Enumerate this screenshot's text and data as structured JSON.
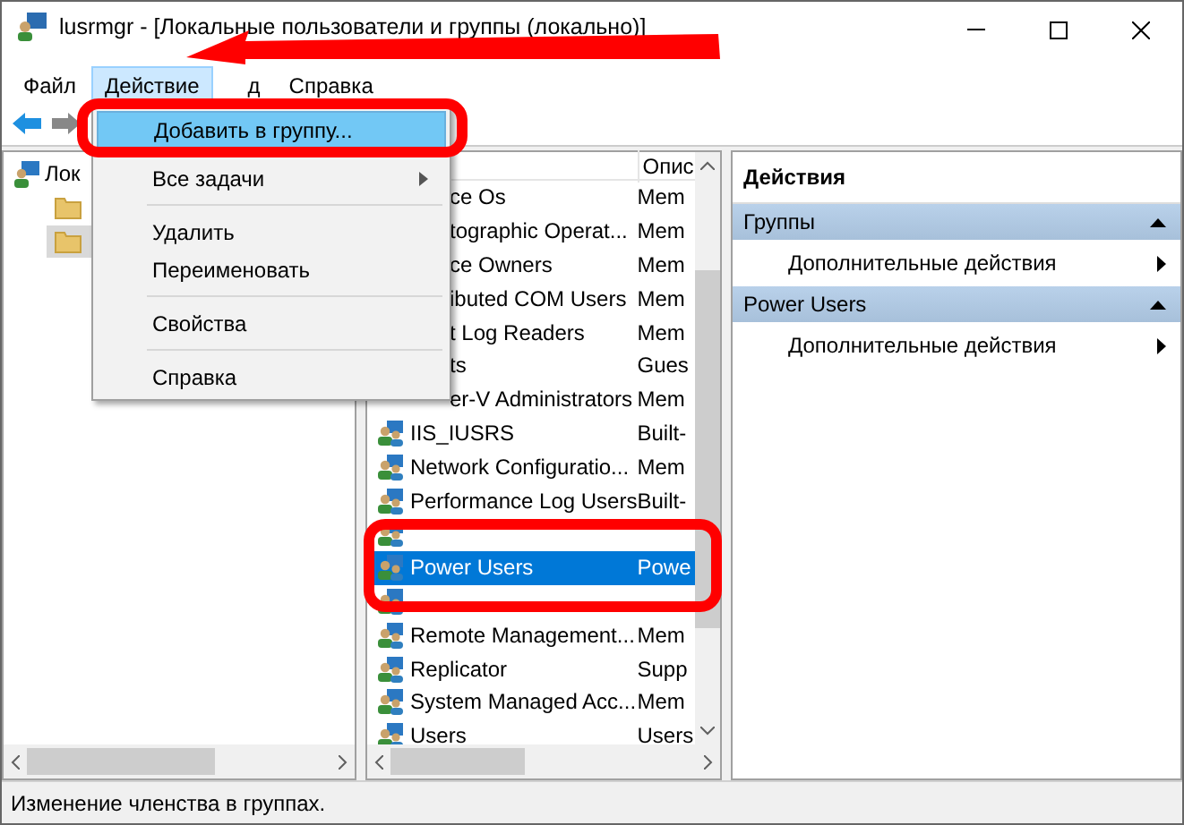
{
  "window": {
    "title": "lusrmgr - [Локальные пользователи и группы (локально)]"
  },
  "menu_bar": [
    {
      "label": "Файл",
      "selected": false
    },
    {
      "label": "Действие",
      "selected": true
    },
    {
      "label": "д",
      "selected": false
    },
    {
      "label": "Справка",
      "selected": false
    }
  ],
  "context_menu": [
    {
      "kind": "item",
      "label": "Добавить в группу...",
      "selected": true
    },
    {
      "kind": "submenu",
      "label": "Все задачи",
      "selected": false
    },
    {
      "kind": "separator"
    },
    {
      "kind": "item",
      "label": "Удалить",
      "selected": false
    },
    {
      "kind": "item",
      "label": "Переименовать",
      "selected": false
    },
    {
      "kind": "separator"
    },
    {
      "kind": "item",
      "label": "Свойства",
      "selected": false
    },
    {
      "kind": "separator"
    },
    {
      "kind": "item",
      "label": "Справка",
      "selected": false
    }
  ],
  "tree": {
    "label": "Лок",
    "children": [
      {
        "selected": false
      },
      {
        "selected": true
      }
    ]
  },
  "list": {
    "columns": [
      "Опис"
    ],
    "rows": [
      {
        "kind": "covered",
        "name": "ce Os",
        "description": "Mem",
        "selected": false
      },
      {
        "kind": "covered",
        "name": "tographic Operat...",
        "description": "Mem",
        "selected": false
      },
      {
        "kind": "covered",
        "name": "ce Owners",
        "description": "Mem",
        "selected": false
      },
      {
        "kind": "covered",
        "name": "ibuted COM Users",
        "description": "Mem",
        "selected": false
      },
      {
        "kind": "covered",
        "name": "t Log Readers",
        "description": "Mem",
        "selected": false
      },
      {
        "kind": "covered",
        "name": "ts",
        "description": "Gues",
        "selected": false
      },
      {
        "kind": "covered",
        "name": "er-V Administrators",
        "description": "Mem",
        "selected": false
      },
      {
        "kind": "group",
        "name": "IIS_IUSRS",
        "description": "Built-",
        "selected": false
      },
      {
        "kind": "group",
        "name": "Network Configuratio...",
        "description": "Mem",
        "selected": false
      },
      {
        "kind": "group",
        "name": "Performance Log Users",
        "description": "Built-",
        "selected": false
      },
      {
        "kind": "hidden",
        "selected": false
      },
      {
        "kind": "group",
        "name": "Power Users",
        "description": "Powe",
        "selected": true
      },
      {
        "kind": "hidden",
        "selected": false
      },
      {
        "kind": "group",
        "name": "Remote Management...",
        "description": "Mem",
        "selected": false
      },
      {
        "kind": "group",
        "name": "Replicator",
        "description": "Supp",
        "selected": false
      },
      {
        "kind": "group",
        "name": "System Managed Acc...",
        "description": "Mem",
        "selected": false
      },
      {
        "kind": "group",
        "name": "Users",
        "description": "Users",
        "selected": false
      }
    ]
  },
  "actions": {
    "title": "Действия",
    "sections": [
      {
        "title": "Группы",
        "items": [
          "Дополнительные действия"
        ]
      },
      {
        "title": "Power Users",
        "items": [
          "Дополнительные действия"
        ]
      }
    ]
  },
  "status_bar": "Изменение членства в группах."
}
